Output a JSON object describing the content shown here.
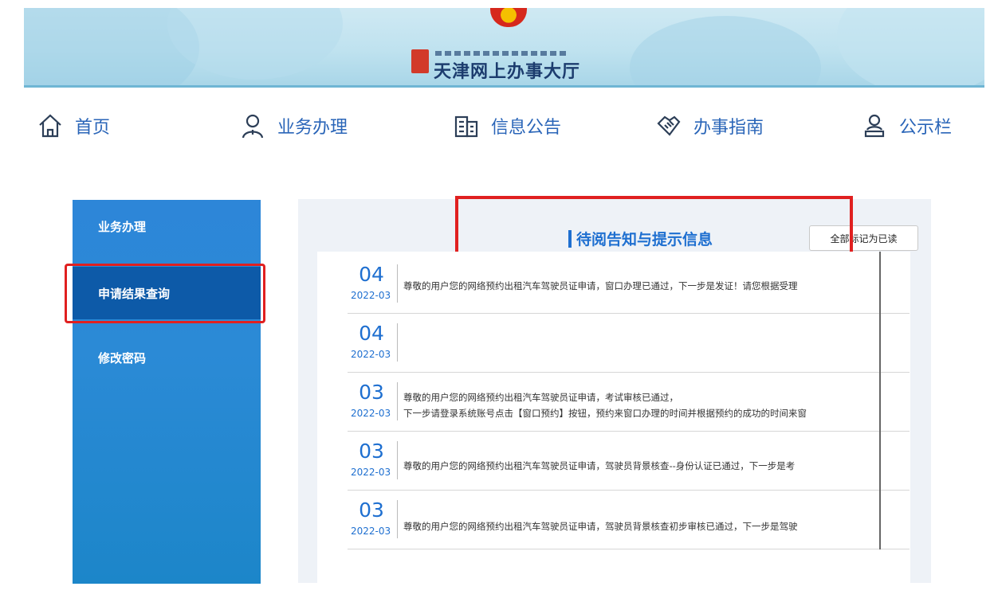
{
  "banner": {
    "title": "天津网上办事大厅"
  },
  "nav": {
    "items": [
      {
        "label": "首页",
        "icon": "home-icon"
      },
      {
        "label": "业务办理",
        "icon": "user-icon"
      },
      {
        "label": "信息公告",
        "icon": "building-icon"
      },
      {
        "label": "办事指南",
        "icon": "handshake-icon"
      },
      {
        "label": "公示栏",
        "icon": "person-stamp-icon"
      }
    ]
  },
  "sidebar": {
    "items": [
      {
        "label": "业务办理",
        "active": false
      },
      {
        "label": "申请结果查询",
        "active": true
      },
      {
        "label": "修改密码",
        "active": false
      }
    ]
  },
  "panel": {
    "title": "待阅告知与提示信息",
    "mark_all_read": "全部标记为已读",
    "messages": [
      {
        "day": "04",
        "ym": "2022-03",
        "lines": [
          "尊敬的用户您的网络预约出租汽车驾驶员证申请，窗口办理已通过，下一步是发证！请您根据受理"
        ]
      },
      {
        "day": "04",
        "ym": "2022-03",
        "lines": []
      },
      {
        "day": "03",
        "ym": "2022-03",
        "lines": [
          "尊敬的用户您的网络预约出租汽车驾驶员证申请，考试审核已通过，",
          "下一步请登录系统账号点击【窗口预约】按钮，预约来窗口办理的时间并根据预约的成功的时间来窗"
        ]
      },
      {
        "day": "03",
        "ym": "2022-03",
        "lines": [
          "尊敬的用户您的网络预约出租汽车驾驶员证申请，驾驶员背景核查--身份认证已通过，下一步是考"
        ]
      },
      {
        "day": "03",
        "ym": "2022-03",
        "lines": [
          "尊敬的用户您的网络预约出租汽车驾驶员证申请，驾驶员背景核查初步审核已通过，下一步是驾驶"
        ]
      }
    ]
  },
  "colors": {
    "accent": "#1e6fd0",
    "sidebar": "#2b8ad6",
    "sidebar_active": "#0d5aa8",
    "highlight": "#e02020"
  }
}
